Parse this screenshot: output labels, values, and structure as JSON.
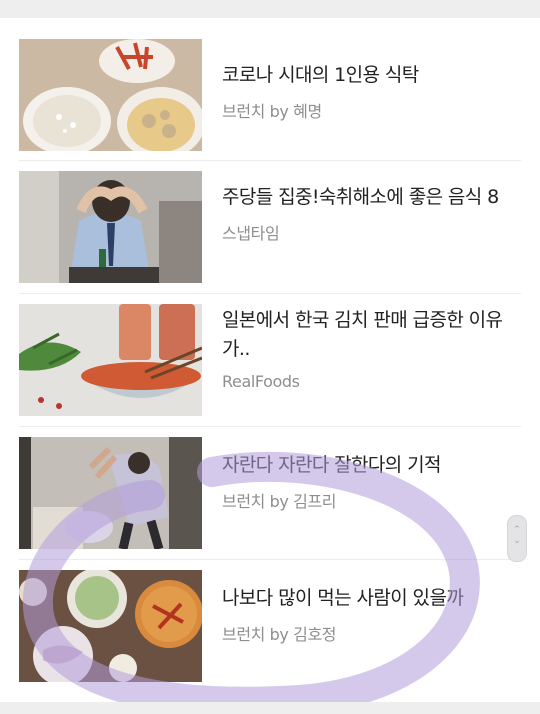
{
  "articles": [
    {
      "title": "코로나 시대의 1인용 식탁",
      "source": "브런치 by 혜명",
      "thumbnail_icon": "soup-and-rice-photo"
    },
    {
      "title": "주당들 집중!숙취해소에 좋은 음식 8",
      "source": "스냅타임",
      "thumbnail_icon": "hungover-man-photo"
    },
    {
      "title": "일본에서 한국 김치 판매 급증한 이유가..",
      "source": "RealFoods",
      "thumbnail_icon": "kimchi-bowl-photo"
    },
    {
      "title": "자란다 자란다 잘한다의 기적",
      "source": "브런치 by 김프리",
      "thumbnail_icon": "father-child-photo"
    },
    {
      "title": "나보다 많이 먹는 사람이 있을까",
      "source": "브런치 by 김호정",
      "thumbnail_icon": "dinner-table-photo"
    }
  ],
  "scroll_handle": {
    "up_glyph": "⌃",
    "down_glyph": "⌄"
  },
  "colors": {
    "title": "#222222",
    "source": "#8e8e8e",
    "divider": "#ececec",
    "annotation_stroke": "#b39ddb"
  }
}
